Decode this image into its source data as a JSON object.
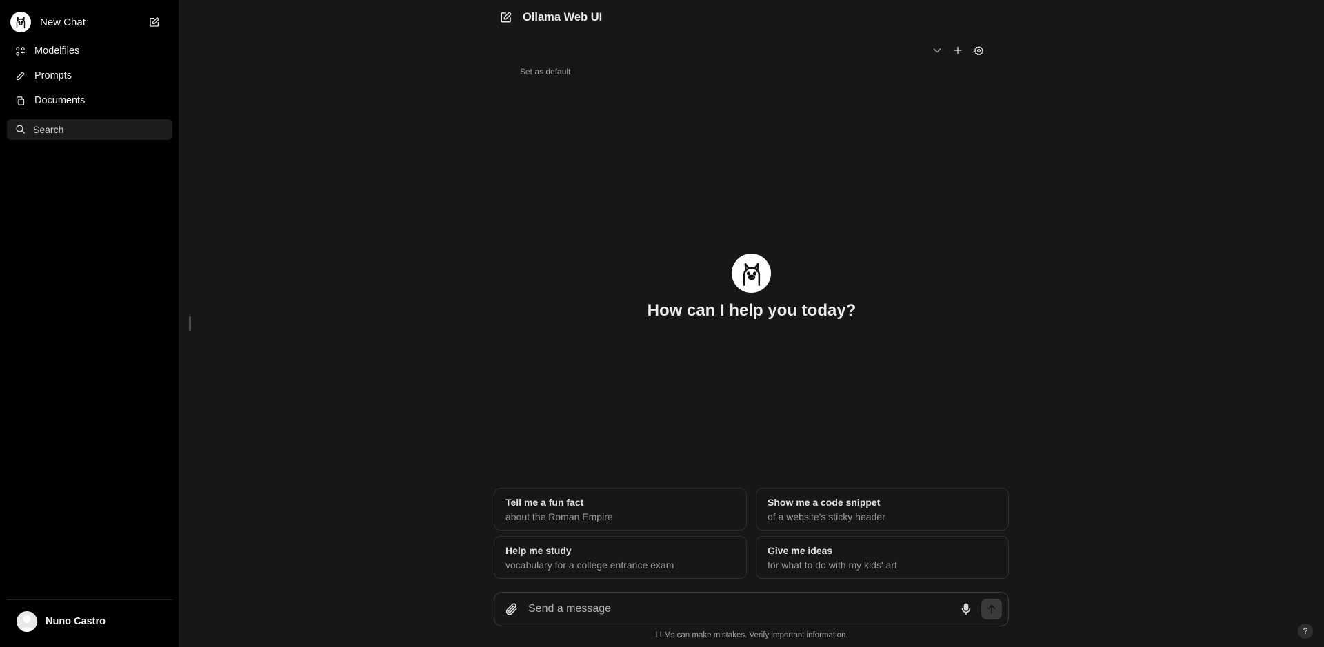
{
  "sidebar": {
    "new_chat_label": "New Chat",
    "items": [
      {
        "label": "Modelfiles",
        "icon": "modelfiles-icon"
      },
      {
        "label": "Prompts",
        "icon": "pencil-icon"
      },
      {
        "label": "Documents",
        "icon": "documents-icon"
      }
    ],
    "search_placeholder": "Search",
    "user_name": "Nuno Castro"
  },
  "header": {
    "title": "Ollama Web UI",
    "set_default_label": "Set as default"
  },
  "welcome": {
    "title": "How can I help you today?"
  },
  "suggestions": [
    {
      "title": "Tell me a fun fact",
      "subtitle": "about the Roman Empire"
    },
    {
      "title": "Show me a code snippet",
      "subtitle": "of a website's sticky header"
    },
    {
      "title": "Help me study",
      "subtitle": "vocabulary for a college entrance exam"
    },
    {
      "title": "Give me ideas",
      "subtitle": "for what to do with my kids' art"
    }
  ],
  "composer": {
    "placeholder": "Send a message",
    "disclaimer": "LLMs can make mistakes. Verify important information."
  },
  "help_label": "?",
  "colors": {
    "background": "#171717",
    "sidebar": "#000000",
    "border": "#2f2f2f"
  }
}
